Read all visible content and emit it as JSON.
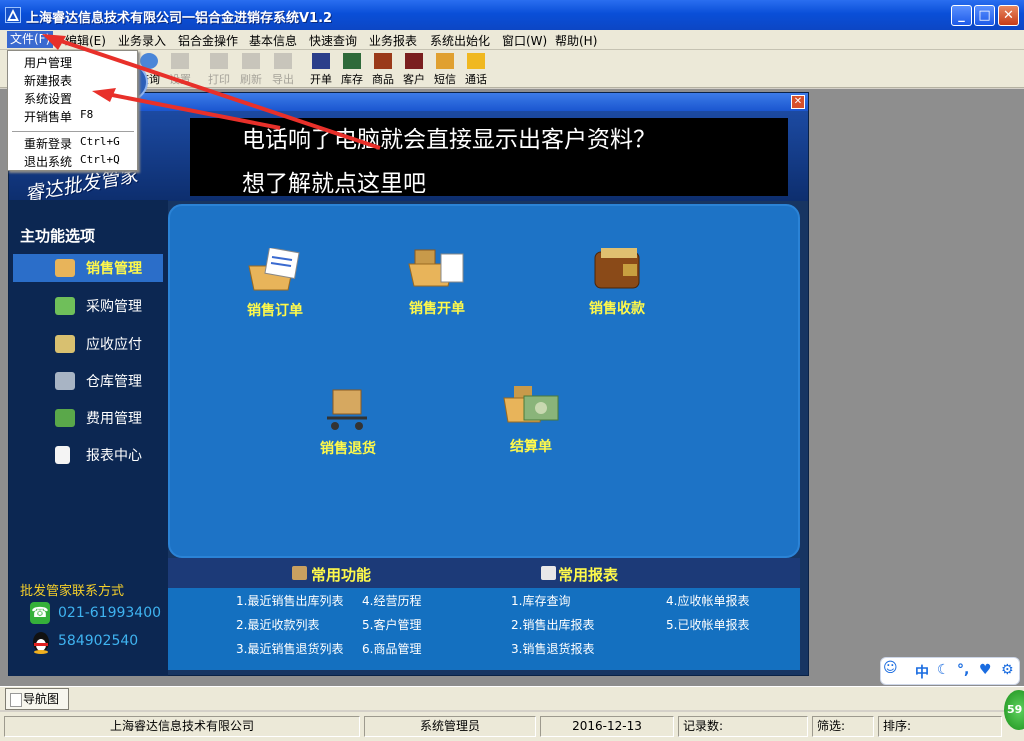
{
  "window": {
    "title": "上海睿达信息技术有限公司一铝合金进销存系统V1.2",
    "controls": {
      "minimize": "_",
      "maximize": "□",
      "close": "✕"
    }
  },
  "menubar": {
    "items": [
      "文件(F)",
      "编辑(E)",
      "业务录入",
      "铝合金操作",
      "基本信息",
      "快速查询",
      "业务报表",
      "系统出始化",
      "窗口(W)",
      "帮助(H)"
    ]
  },
  "file_menu": {
    "items": [
      {
        "label": "用户管理",
        "shortcut": ""
      },
      {
        "label": "新建报表",
        "shortcut": ""
      },
      {
        "label": "系统设置",
        "shortcut": ""
      },
      {
        "label": "开销售单",
        "shortcut": "F8"
      },
      {
        "label": "重新登录",
        "shortcut": "Ctrl+G"
      },
      {
        "label": "退出系统",
        "shortcut": "Ctrl+Q"
      }
    ]
  },
  "toolbar": {
    "items": [
      {
        "label": "查询",
        "icon": "search-icon",
        "enabled": true
      },
      {
        "label": "设置",
        "icon": "settings-icon",
        "enabled": false
      },
      {
        "label": "打印",
        "icon": "printer-icon",
        "enabled": false
      },
      {
        "label": "刷新",
        "icon": "refresh-icon",
        "enabled": false
      },
      {
        "label": "导出",
        "icon": "export-icon",
        "enabled": false
      },
      {
        "label": "开单",
        "icon": "order-icon",
        "enabled": true
      },
      {
        "label": "库存",
        "icon": "inventory-icon",
        "enabled": true
      },
      {
        "label": "商品",
        "icon": "product-icon",
        "enabled": true
      },
      {
        "label": "客户",
        "icon": "customer-icon",
        "enabled": true
      },
      {
        "label": "短信",
        "icon": "sms-icon",
        "enabled": true
      },
      {
        "label": "通话",
        "icon": "call-icon",
        "enabled": true
      }
    ]
  },
  "banner": {
    "line1": "电话响了电脑就会直接显示出客户资料？",
    "line2": "想了解就点这里吧"
  },
  "logo": {
    "text": "睿达批发管家"
  },
  "sidebar": {
    "title": "主功能选项",
    "items": [
      {
        "label": "销售管理",
        "icon": "basket-icon",
        "active": true
      },
      {
        "label": "采购管理",
        "icon": "purchase-icon",
        "active": false
      },
      {
        "label": "应收应付",
        "icon": "money-icon",
        "active": false
      },
      {
        "label": "仓库管理",
        "icon": "warehouse-icon",
        "active": false
      },
      {
        "label": "费用管理",
        "icon": "expense-icon",
        "active": false
      },
      {
        "label": "报表中心",
        "icon": "report-icon",
        "active": false
      }
    ],
    "contact_title": "批发管家联系方式",
    "phone": "021-61993400",
    "qq": "584902540"
  },
  "functions": {
    "items": [
      {
        "label": "销售订单",
        "icon": "sales-order-icon"
      },
      {
        "label": "销售开单",
        "icon": "sales-invoice-icon"
      },
      {
        "label": "销售收款",
        "icon": "wallet-icon"
      },
      {
        "label": "销售退货",
        "icon": "return-cart-icon"
      },
      {
        "label": "结算单",
        "icon": "settlement-icon"
      }
    ]
  },
  "common_functions": {
    "title": "常用功能",
    "items": [
      "1.最近销售出库列表",
      "4.经营历程",
      "2.最近收款列表",
      "5.客户管理",
      "3.最近销售退货列表",
      "6.商品管理"
    ]
  },
  "common_reports": {
    "title": "常用报表",
    "items": [
      "1.库存查询",
      "4.应收帐单报表",
      "2.销售出库报表",
      "5.已收帐单报表",
      "3.销售退货报表"
    ]
  },
  "statusbar": {
    "nav_tab": "导航图",
    "company": "上海睿达信息技术有限公司",
    "user": "系统管理员",
    "date": "2016-12-13",
    "records_label": "记录数:",
    "filter_label": "筛选:",
    "sort_label": "排序:"
  },
  "ime": {
    "mode": "中",
    "badge": "59"
  },
  "colors": {
    "accent": "#1d73c6",
    "highlight_text": "#fff94a",
    "arrow": "#e8302a"
  }
}
